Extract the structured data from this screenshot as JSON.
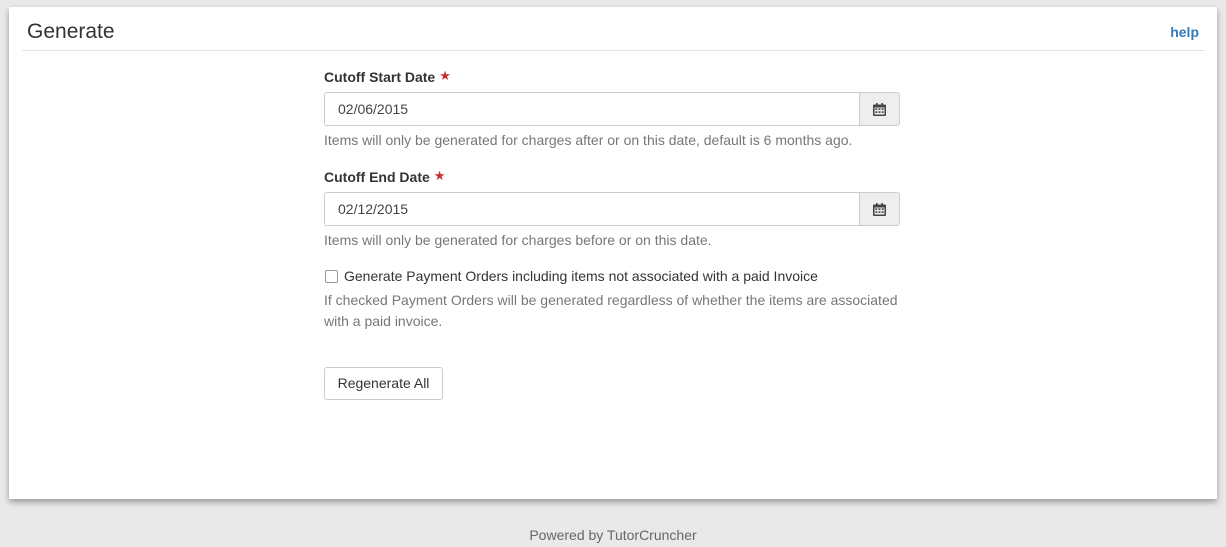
{
  "header": {
    "title": "Generate",
    "help_label": "help"
  },
  "form": {
    "start_date": {
      "label": "Cutoff Start Date",
      "required_mark": "★",
      "value": "02/06/2015",
      "help": "Items will only be generated for charges after or on this date, default is 6 months ago."
    },
    "end_date": {
      "label": "Cutoff End Date",
      "required_mark": "★",
      "value": "02/12/2015",
      "help": "Items will only be generated for charges before or on this date."
    },
    "include_unpaid": {
      "label": "Generate Payment Orders including items not associated with a paid Invoice",
      "checked": false,
      "help_line1": "If checked Payment Orders will be generated regardless of whether the items are associated",
      "help_line2": "with a paid invoice."
    },
    "submit_label": "Regenerate All"
  },
  "footer": {
    "text": "Powered by TutorCruncher"
  },
  "colors": {
    "accent": "#337ab7",
    "required": "#c9302c"
  },
  "icons": {
    "date_picker": "calendar-icon"
  }
}
